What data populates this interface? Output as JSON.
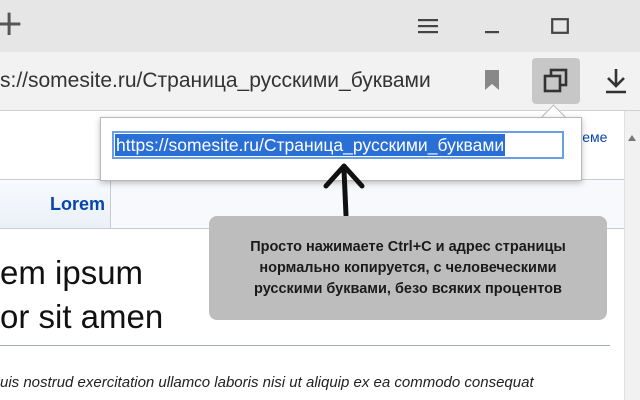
{
  "browser": {
    "address": "s://somesite.ru/Страница_русскими_буквами",
    "window_controls": {
      "menu_icon": "hamburger-icon",
      "minimize_icon": "minimize-icon",
      "maximize_icon": "maximize-icon",
      "newtab_icon": "plus-icon"
    },
    "toolbar_icons": [
      "bookmark-icon",
      "copy-icon",
      "download-icon"
    ]
  },
  "popup": {
    "url": "https://somesite.ru/Страница_русскими_буквами"
  },
  "page": {
    "topright_link": "теме",
    "tab_label": "Lorem",
    "heading_line1": "em ipsum",
    "heading_line2": "or sit amen",
    "body_line": "uis nostrud exercitation ullamco laboris nisi ut aliquip ex ea commodo consequat"
  },
  "tooltip": {
    "text": "Просто нажимаете Ctrl+C и адрес страницы\nнормально копируется, с человеческими\nрусскими буквами, безо всяких процентов"
  },
  "colors": {
    "selection": "#2a6fd6",
    "tooltip_bg": "#bdbdbd",
    "link": "#0645ad"
  }
}
